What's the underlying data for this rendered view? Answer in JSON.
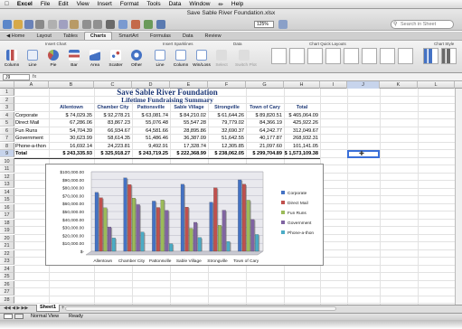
{
  "menubar": {
    "app": "Excel",
    "items": [
      "File",
      "Edit",
      "View",
      "Insert",
      "Format",
      "Tools",
      "Data",
      "Window",
      "Help"
    ]
  },
  "window": {
    "title": "Save Sable River Foundation.xlsx"
  },
  "toolbar": {
    "zoom": "125%",
    "search_placeholder": "Search in Sheet"
  },
  "ribbon": {
    "tabs": [
      "Home",
      "Layout",
      "Tables",
      "Charts",
      "SmartArt",
      "Formulas",
      "Data",
      "Review"
    ],
    "active_tab": "Charts",
    "groups": [
      "Insert Chart",
      "Insert Sparklines",
      "Data",
      "Chart Quick Layouts",
      "Chart Style"
    ],
    "insert_chart_buttons": [
      "Column",
      "Line",
      "Pie",
      "Bar",
      "Area",
      "Scatter",
      "Other"
    ],
    "sparkline_buttons": [
      "Line",
      "Column",
      "Win/Loss"
    ],
    "data_buttons": [
      "Select",
      "Switch Plot"
    ]
  },
  "formula_bar": {
    "name_box": "J9",
    "fx": "fx"
  },
  "columns": [
    "A",
    "B",
    "C",
    "D",
    "E",
    "F",
    "G",
    "H",
    "I",
    "J",
    "K",
    "L"
  ],
  "rows": [
    "1",
    "2",
    "3",
    "4",
    "5",
    "6",
    "7",
    "8",
    "9",
    "10",
    "11",
    "12",
    "13",
    "14",
    "15",
    "16",
    "17",
    "18",
    "19",
    "20",
    "21",
    "22",
    "23",
    "24",
    "25",
    "26",
    "27",
    "28"
  ],
  "sheet": {
    "title": "Save Sable River Foundation",
    "subtitle": "Lifetime Fundraising Summary",
    "headers": [
      "Allentown",
      "Chamber City",
      "Pattonsville",
      "Sable Village",
      "Strongville",
      "Town of Cary",
      "Total"
    ],
    "data_rows": [
      {
        "label": "Corporate",
        "values": [
          "$  74,029.35",
          "$  92,278.21",
          "$  63,081.74",
          "$  84,210.02",
          "$  61,644.26",
          "$  89,820.51",
          "$   465,064.09"
        ]
      },
      {
        "label": "Direct Mail",
        "values": [
          "67,286.06",
          "83,867.23",
          "55,076.48",
          "55,547.28",
          "79,779.02",
          "84,366.19",
          "425,922.26"
        ]
      },
      {
        "label": "Fun Runs",
        "values": [
          "54,704.39",
          "66,934.67",
          "64,581.66",
          "28,895.86",
          "32,690.37",
          "64,242.77",
          "312,049.67"
        ]
      },
      {
        "label": "Government",
        "values": [
          "30,623.99",
          "58,614.35",
          "51,486.46",
          "36,387.09",
          "51,642.55",
          "40,177.87",
          "268,932.31"
        ]
      },
      {
        "label": "Phone-a-thon",
        "values": [
          "16,692.14",
          "24,223.81",
          "9,492.91",
          "17,328.74",
          "12,305.85",
          "21,097.60",
          "101,141.05"
        ]
      }
    ],
    "total_row": {
      "label": "Total",
      "values": [
        "$ 243,335.93",
        "$ 325,918.27",
        "$ 243,719.25",
        "$ 222,368.99",
        "$ 238,062.05",
        "$ 299,704.89",
        "$ 1,573,109.38"
      ]
    }
  },
  "chart_data": {
    "type": "bar",
    "categories": [
      "Allentown",
      "Chamber City",
      "Pattonsville",
      "Sable Village",
      "Strongville",
      "Town of Cary"
    ],
    "series": [
      {
        "name": "Corporate",
        "values": [
          74029.35,
          92278.21,
          63081.74,
          84210.02,
          61644.26,
          89820.51
        ],
        "color": "#4472c4"
      },
      {
        "name": "Direct Mail",
        "values": [
          67286.06,
          83867.23,
          55076.48,
          55547.28,
          79779.02,
          84366.19
        ],
        "color": "#c0504d"
      },
      {
        "name": "Fun Runs",
        "values": [
          54704.39,
          66934.67,
          64581.66,
          28895.86,
          32690.37,
          64242.77
        ],
        "color": "#9bbb59"
      },
      {
        "name": "Government",
        "values": [
          30623.99,
          58614.35,
          51486.46,
          36387.09,
          51642.55,
          40177.87
        ],
        "color": "#8064a2"
      },
      {
        "name": "Phone-a-thon",
        "values": [
          16692.14,
          24223.81,
          9492.91,
          17328.74,
          12305.85,
          21097.6
        ],
        "color": "#4bacc6"
      }
    ],
    "yticks": [
      "$100,000.00",
      "$90,000.00",
      "$80,000.00",
      "$70,000.00",
      "$60,000.00",
      "$50,000.00",
      "$40,000.00",
      "$30,000.00",
      "$20,000.00",
      "$10,000.00",
      "$-"
    ],
    "ylim": [
      0,
      100000
    ],
    "legend": "right",
    "grid": true
  },
  "sheet_tabs": {
    "active": "Sheet1"
  },
  "status": {
    "view": "Normal View",
    "state": "Ready"
  }
}
